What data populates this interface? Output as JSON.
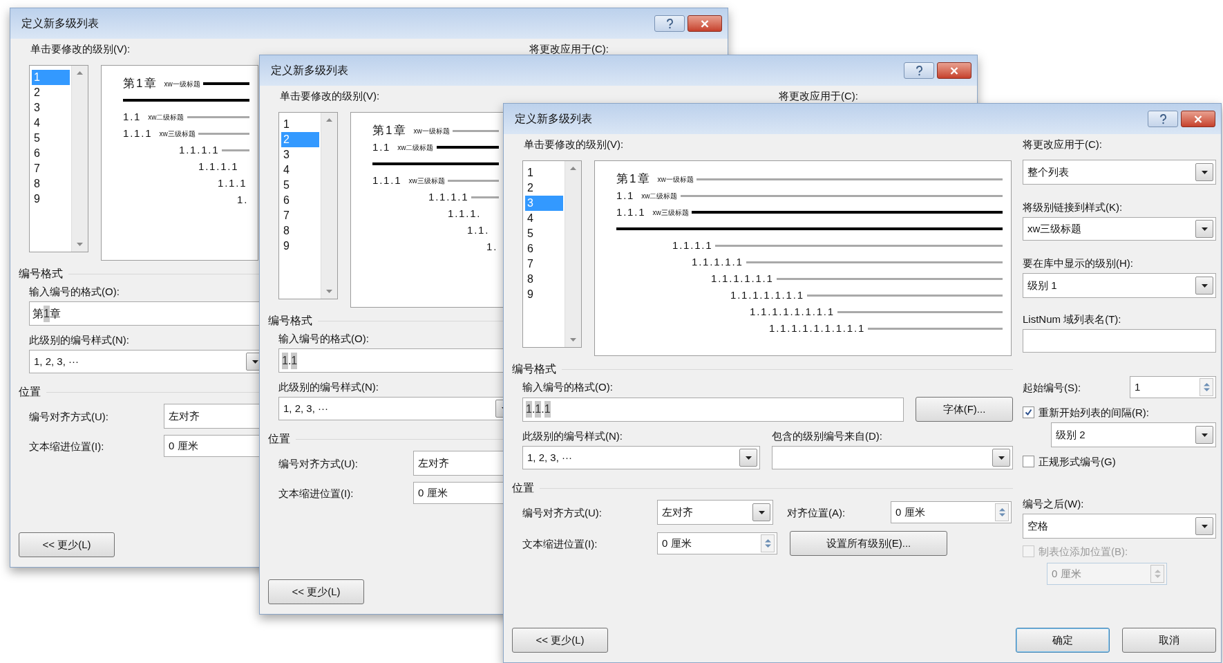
{
  "dialogs": [
    {
      "title": "定义新多级列表",
      "level_label": "单击要修改的级别(V):",
      "apply_label": "将更改应用于(C):",
      "levels": [
        {
          "label": "1",
          "selected": true
        },
        {
          "label": "2",
          "selected": false
        },
        {
          "label": "3",
          "selected": false
        },
        {
          "label": "4",
          "selected": false
        },
        {
          "label": "5",
          "selected": false
        },
        {
          "label": "6",
          "selected": false
        },
        {
          "label": "7",
          "selected": false
        },
        {
          "label": "8",
          "selected": false
        },
        {
          "label": "9",
          "selected": false
        }
      ],
      "preview": [
        {
          "number": "第1章",
          "style": "xw一级标题",
          "active": true
        },
        {
          "number": "1.1",
          "style": "xw二级标题",
          "active": false
        },
        {
          "number": "1.1.1",
          "style": "xw三级标题",
          "active": false
        },
        {
          "number": "1.1.1.1",
          "active": false
        },
        {
          "number": "1.1.1.1"
        },
        {
          "number": "1.1.1"
        },
        {
          "number": "1."
        }
      ],
      "format_heading": "编号格式",
      "format_label": "输入编号的格式(O):",
      "format_value": [
        {
          "text": "第",
          "kind": "literal"
        },
        {
          "text": "1",
          "kind": "number"
        },
        {
          "text": "章",
          "kind": "literal"
        }
      ],
      "style_label": "此级别的编号样式(N):",
      "style_value": "1, 2, 3, ···",
      "position_heading": "位置",
      "align_label": "编号对齐方式(U):",
      "align_value": "左对齐",
      "indent_label": "文本缩进位置(I):",
      "indent_value": "0 厘米",
      "less_button": "<< 更少(L)"
    },
    {
      "title": "定义新多级列表",
      "level_label": "单击要修改的级别(V):",
      "apply_label": "将更改应用于(C):",
      "levels": [
        {
          "label": "1",
          "selected": false
        },
        {
          "label": "2",
          "selected": true
        },
        {
          "label": "3",
          "selected": false
        },
        {
          "label": "4",
          "selected": false
        },
        {
          "label": "5",
          "selected": false
        },
        {
          "label": "6",
          "selected": false
        },
        {
          "label": "7",
          "selected": false
        },
        {
          "label": "8",
          "selected": false
        },
        {
          "label": "9",
          "selected": false
        }
      ],
      "preview": [
        {
          "number": "第1章",
          "style": "xw一级标题",
          "active": false
        },
        {
          "number": "1.1",
          "style": "xw二级标题",
          "active": true
        },
        {
          "number": "1.1.1",
          "style": "xw三级标题",
          "active": false
        },
        {
          "number": "1.1.1.1",
          "active": false
        },
        {
          "number": "1.1.1."
        },
        {
          "number": "1.1."
        },
        {
          "number": "1."
        }
      ],
      "format_heading": "编号格式",
      "format_label": "输入编号的格式(O):",
      "format_value": [
        {
          "text": "1",
          "kind": "number"
        },
        {
          "text": ".",
          "kind": "literal"
        },
        {
          "text": "1",
          "kind": "number"
        }
      ],
      "style_label": "此级别的编号样式(N):",
      "style_value": "1, 2, 3, ···",
      "position_heading": "位置",
      "align_label": "编号对齐方式(U):",
      "align_value": "左对齐",
      "indent_label": "文本缩进位置(I):",
      "indent_value": "0 厘米",
      "less_button": "<< 更少(L)"
    },
    {
      "title": "定义新多级列表",
      "level_label": "单击要修改的级别(V):",
      "apply_label": "将更改应用于(C):",
      "levels": [
        {
          "label": "1",
          "selected": false
        },
        {
          "label": "2",
          "selected": false
        },
        {
          "label": "3",
          "selected": true
        },
        {
          "label": "4",
          "selected": false
        },
        {
          "label": "5",
          "selected": false
        },
        {
          "label": "6",
          "selected": false
        },
        {
          "label": "7",
          "selected": false
        },
        {
          "label": "8",
          "selected": false
        },
        {
          "label": "9",
          "selected": false
        }
      ],
      "preview": [
        {
          "number": "第1章",
          "style": "xw一级标题",
          "active": false
        },
        {
          "number": "1.1",
          "style": "xw二级标题",
          "active": false
        },
        {
          "number": "1.1.1",
          "style": "xw三级标题",
          "active": true
        },
        {
          "number": "1.1.1.1",
          "active": false
        },
        {
          "number": "1.1.1.1.1",
          "active": false
        },
        {
          "number": "1.1.1.1.1.1",
          "active": false
        },
        {
          "number": "1.1.1.1.1.1.1",
          "active": false
        },
        {
          "number": "1.1.1.1.1.1.1.1",
          "active": false
        },
        {
          "number": "1.1.1.1.1.1.1.1.1",
          "active": false
        }
      ],
      "format_heading": "编号格式",
      "format_label": "输入编号的格式(O):",
      "format_value": [
        {
          "text": "1",
          "kind": "number"
        },
        {
          "text": ".",
          "kind": "literal"
        },
        {
          "text": "1",
          "kind": "number"
        },
        {
          "text": ".",
          "kind": "literal"
        },
        {
          "text": "1",
          "kind": "number"
        }
      ],
      "font_button": "字体(F)...",
      "style_label": "此级别的编号样式(N):",
      "style_value": "1, 2, 3, ···",
      "include_label": "包含的级别编号来自(D):",
      "position_heading": "位置",
      "align_label": "编号对齐方式(U):",
      "align_value": "左对齐",
      "align_at_label": "对齐位置(A):",
      "align_at_value": "0 厘米",
      "indent_label": "文本缩进位置(I):",
      "indent_value": "0 厘米",
      "set_all_button": "设置所有级别(E)...",
      "less_button": "<< 更少(L)",
      "apply_value": "整个列表",
      "link_label": "将级别链接到样式(K):",
      "link_value": "xw三级标题",
      "gallery_label": "要在库中显示的级别(H):",
      "gallery_value": "级别 1",
      "listnum_label": "ListNum 域列表名(T):",
      "start_label": "起始编号(S):",
      "start_value": "1",
      "restart": {
        "label": "重新开始列表的间隔(R):",
        "checked": true
      },
      "restart_value": "级别 2",
      "legal": {
        "label": "正规形式编号(G)",
        "checked": false
      },
      "after_label": "编号之后(W):",
      "after_value": "空格",
      "tab_stop": {
        "label": "制表位添加位置(B):",
        "checked": false,
        "disabled": true
      },
      "tab_stop_value": "0 厘米",
      "ok_button": "确定",
      "cancel_button": "取消"
    }
  ]
}
